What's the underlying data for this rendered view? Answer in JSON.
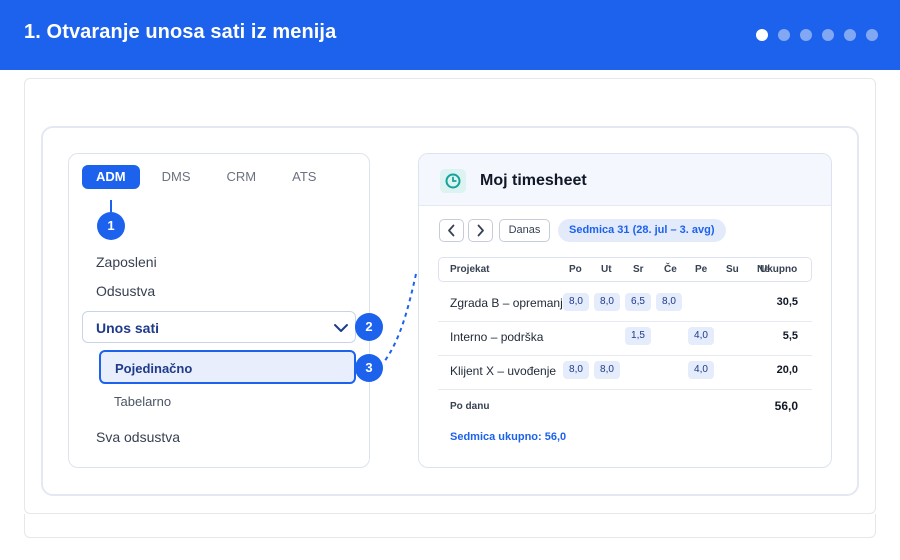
{
  "header": {
    "title": "1. Otvaranje unosa sati iz menija",
    "slides_total": 6,
    "slide_active": 1
  },
  "menu": {
    "tabs": [
      "ADM",
      "DMS",
      "CRM",
      "ATS"
    ],
    "active_tab": "ADM",
    "items": {
      "zaposleni": "Zaposleni",
      "odsustva": "Odsustva",
      "unos_sati": "Unos sati",
      "pojedinacno": "Pojedinačno",
      "tabelarno": "Tabelarno",
      "sva_odsustva": "Sva odsustva"
    }
  },
  "steps": [
    "1",
    "2",
    "3"
  ],
  "timesheet": {
    "title": "Moj timesheet",
    "icon": "clock-icon",
    "prev_icon": "chevron-left-icon",
    "next_icon": "chevron-right-icon",
    "today_label": "Danas",
    "week_label": "Sedmica 31 (28. jul – 3. avg)",
    "columns": {
      "project": "Projekat",
      "days": [
        "Po",
        "Ut",
        "Sr",
        "Če",
        "Pe",
        "Su",
        "Ne"
      ],
      "total": "Ukupno"
    },
    "rows": [
      {
        "name": "Zgrada B – opremanje",
        "hours": [
          "8,0",
          "8,0",
          "6,5",
          "8,0",
          "",
          "",
          ""
        ],
        "total": "30,5"
      },
      {
        "name": "Interno – podrška",
        "hours": [
          "",
          "",
          "1,5",
          "",
          "4,0",
          "",
          ""
        ],
        "total": "5,5"
      },
      {
        "name": "Klijent X – uvođenje",
        "hours": [
          "8,0",
          "8,0",
          "",
          "",
          "4,0",
          "",
          ""
        ],
        "total": "20,0"
      }
    ],
    "per_day_label": "Po danu",
    "per_day_total": "56,0",
    "week_total": "Sedmica ukupno: 56,0"
  },
  "colors": {
    "primary": "#1c62ec",
    "chip_bg": "#e5ecfb",
    "clock": "#14a39a"
  }
}
